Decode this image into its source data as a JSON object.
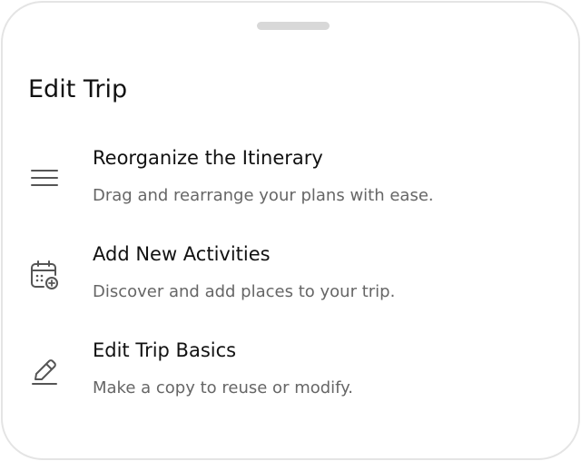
{
  "sheet": {
    "title": "Edit Trip",
    "options": [
      {
        "icon": "menu-lines-icon",
        "title": "Reorganize the Itinerary",
        "description": "Drag and rearrange your plans with ease."
      },
      {
        "icon": "calendar-add-icon",
        "title": "Add New Activities",
        "description": "Discover and add places to your trip."
      },
      {
        "icon": "pencil-edit-icon",
        "title": "Edit Trip Basics",
        "description": "Make a copy to reuse or modify."
      }
    ]
  }
}
